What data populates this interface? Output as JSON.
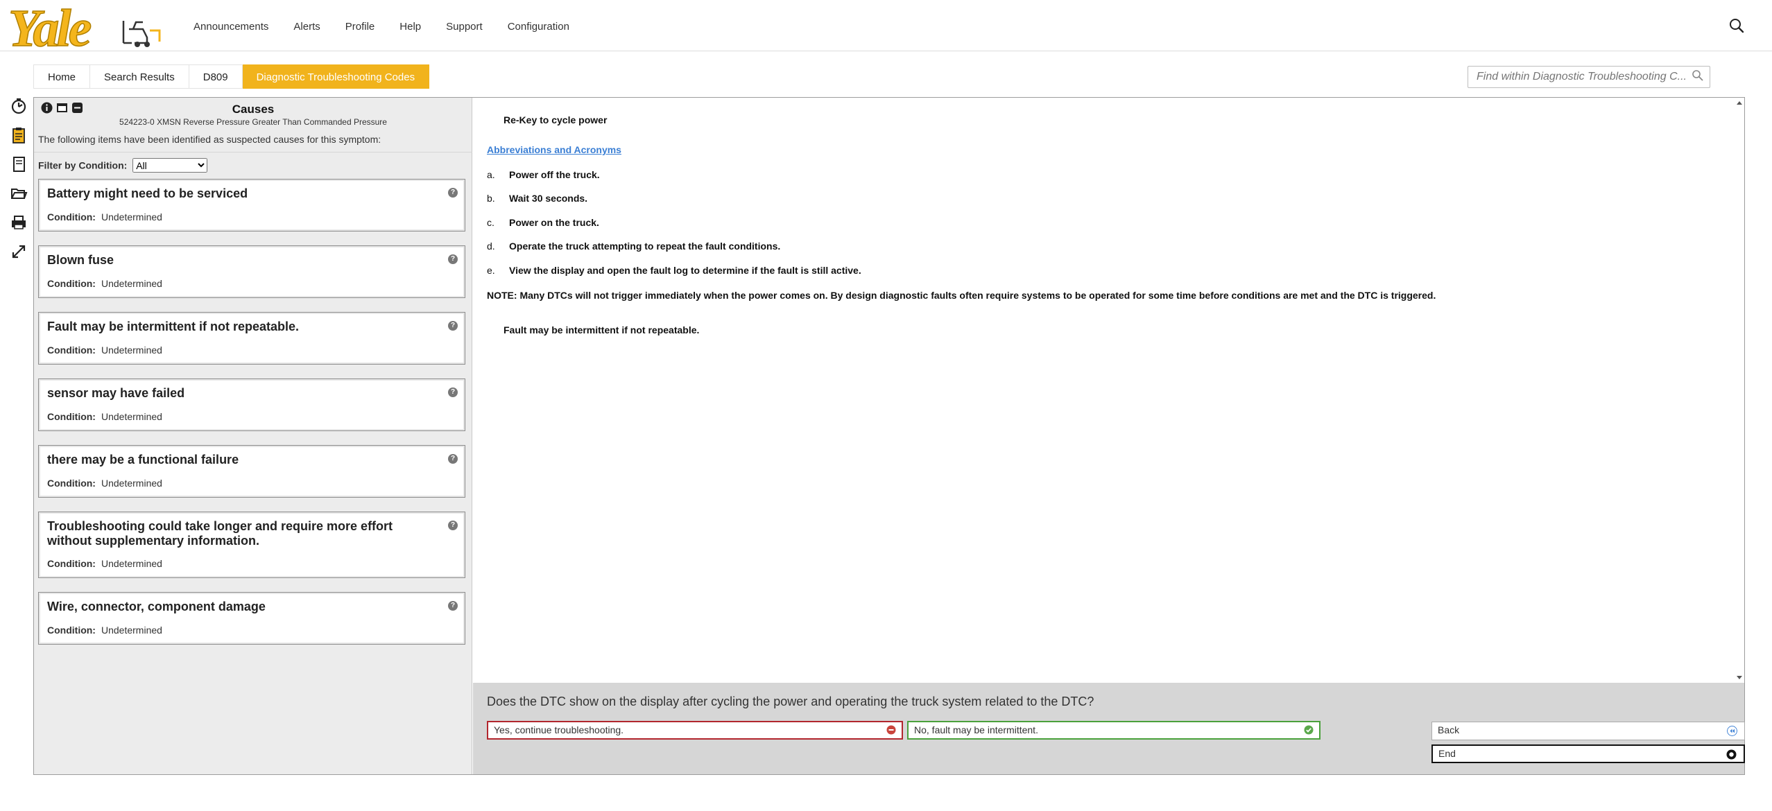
{
  "header": {
    "logo_text": "Yale",
    "nav": [
      "Announcements",
      "Alerts",
      "Profile",
      "Help",
      "Support",
      "Configuration"
    ],
    "search_icon": "search-icon"
  },
  "breadcrumb": [
    "Home",
    "Search Results",
    "D809",
    "Diagnostic Troubleshooting Codes"
  ],
  "find": {
    "placeholder": "Find within Diagnostic Troubleshooting C..."
  },
  "rail_icons": [
    "timer-icon",
    "clipboard-icon",
    "notebook-icon",
    "folder-open-icon",
    "printer-icon",
    "expand-icon"
  ],
  "causes_panel": {
    "title": "Causes",
    "subtitle": "524223-0 XMSN Reverse Pressure Greater Than Commanded Pressure",
    "intro": "The following items have been identified as suspected causes for this symptom:",
    "filter_label": "Filter by Condition:",
    "filter_value": "All",
    "condition_label": "Condition:",
    "items": [
      {
        "title": "Battery might need to be serviced",
        "condition": "Undetermined"
      },
      {
        "title": "Blown fuse",
        "condition": "Undetermined"
      },
      {
        "title": "Fault may be intermittent if not repeatable.",
        "condition": "Undetermined"
      },
      {
        "title": "sensor may have failed",
        "condition": "Undetermined"
      },
      {
        "title": "there may be a functional failure",
        "condition": "Undetermined"
      },
      {
        "title": "Troubleshooting could take longer and require more effort without supplementary information.",
        "condition": "Undetermined"
      },
      {
        "title": "Wire, connector, component damage",
        "condition": "Undetermined"
      }
    ]
  },
  "content": {
    "heading": "Re-Key to cycle power",
    "abbreviations_link": "Abbreviations and Acronyms",
    "steps": [
      {
        "letter": "a.",
        "text": "Power off the truck."
      },
      {
        "letter": "b.",
        "text": "Wait 30 seconds."
      },
      {
        "letter": "c.",
        "text": "Power on the truck."
      },
      {
        "letter": "d.",
        "text": "Operate the truck attempting to repeat the fault conditions."
      },
      {
        "letter": "e.",
        "text": "View the display and open the fault log to determine if the fault is still active."
      }
    ],
    "note": "NOTE: Many DTCs will not trigger immediately when the power comes on. By design diagnostic faults often require systems to be operated for some time before conditions are met and the DTC is triggered.",
    "fault_note": "Fault may be intermittent if not repeatable."
  },
  "question": {
    "text": "Does the DTC show on the display after cycling the power and operating the truck system related to the DTC?",
    "yes_label": "Yes, continue troubleshooting.",
    "no_label": "No, fault may be intermittent.",
    "back_label": "Back",
    "end_label": "End"
  },
  "colors": {
    "brand": "#f1b31c",
    "yes_border": "#b2262d",
    "no_border": "#4aa13b",
    "link": "#3b7fd4"
  }
}
